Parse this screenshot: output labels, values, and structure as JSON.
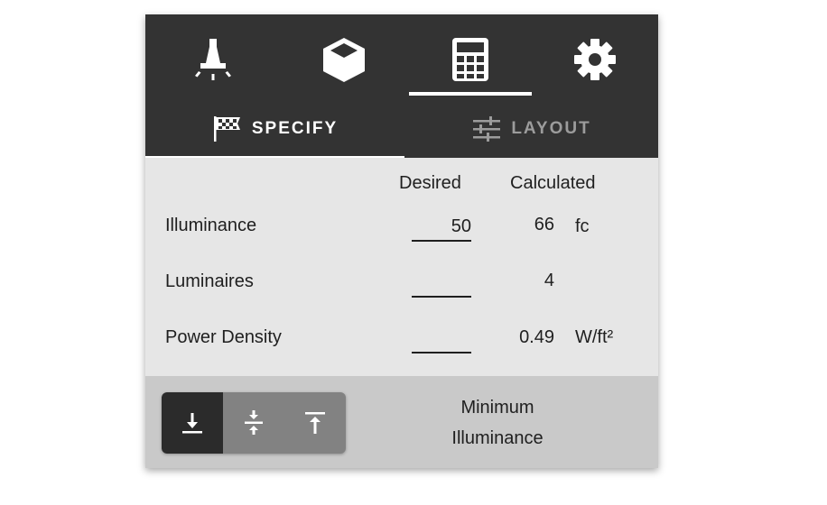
{
  "nav": {
    "items": [
      {
        "icon": "ceiling-lamp-icon"
      },
      {
        "icon": "cube-icon"
      },
      {
        "icon": "calculator-icon",
        "active": true
      },
      {
        "icon": "gear-icon"
      }
    ]
  },
  "subtabs": {
    "specify": "SPECIFY",
    "layout": "LAYOUT"
  },
  "table": {
    "col_desired": "Desired",
    "col_calculated": "Calculated",
    "rows": [
      {
        "label": "Illuminance",
        "desired": "50",
        "calculated": "66",
        "unit": "fc"
      },
      {
        "label": "Luminaires",
        "desired": "",
        "calculated": "4",
        "unit": ""
      },
      {
        "label": "Power Density",
        "desired": "",
        "calculated": "0.49",
        "unit": "W/ft²"
      }
    ]
  },
  "footer": {
    "mode_line1": "Minimum",
    "mode_line2": "Illuminance",
    "buttons": [
      "align-bottom-icon",
      "align-center-icon",
      "align-top-icon"
    ]
  },
  "colors": {
    "header": "#333333",
    "body": "#e6e6e6",
    "footer": "#c9c9c9",
    "segment": "#828282",
    "segment_active": "#2b2b2b"
  }
}
